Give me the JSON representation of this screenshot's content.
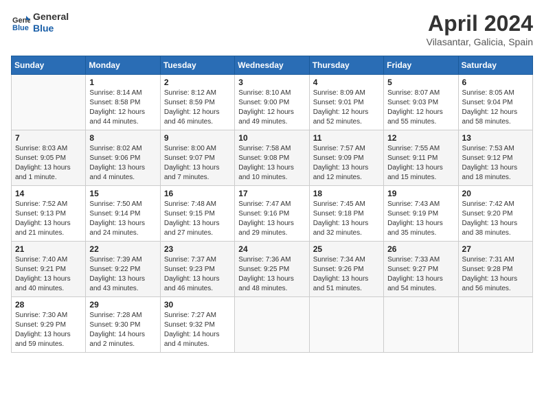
{
  "logo": {
    "line1": "General",
    "line2": "Blue"
  },
  "title": "April 2024",
  "location": "Vilasantar, Galicia, Spain",
  "days_of_week": [
    "Sunday",
    "Monday",
    "Tuesday",
    "Wednesday",
    "Thursday",
    "Friday",
    "Saturday"
  ],
  "weeks": [
    [
      null,
      {
        "num": "1",
        "sunrise": "Sunrise: 8:14 AM",
        "sunset": "Sunset: 8:58 PM",
        "daylight": "Daylight: 12 hours and 44 minutes."
      },
      {
        "num": "2",
        "sunrise": "Sunrise: 8:12 AM",
        "sunset": "Sunset: 8:59 PM",
        "daylight": "Daylight: 12 hours and 46 minutes."
      },
      {
        "num": "3",
        "sunrise": "Sunrise: 8:10 AM",
        "sunset": "Sunset: 9:00 PM",
        "daylight": "Daylight: 12 hours and 49 minutes."
      },
      {
        "num": "4",
        "sunrise": "Sunrise: 8:09 AM",
        "sunset": "Sunset: 9:01 PM",
        "daylight": "Daylight: 12 hours and 52 minutes."
      },
      {
        "num": "5",
        "sunrise": "Sunrise: 8:07 AM",
        "sunset": "Sunset: 9:03 PM",
        "daylight": "Daylight: 12 hours and 55 minutes."
      },
      {
        "num": "6",
        "sunrise": "Sunrise: 8:05 AM",
        "sunset": "Sunset: 9:04 PM",
        "daylight": "Daylight: 12 hours and 58 minutes."
      }
    ],
    [
      {
        "num": "7",
        "sunrise": "Sunrise: 8:03 AM",
        "sunset": "Sunset: 9:05 PM",
        "daylight": "Daylight: 13 hours and 1 minute."
      },
      {
        "num": "8",
        "sunrise": "Sunrise: 8:02 AM",
        "sunset": "Sunset: 9:06 PM",
        "daylight": "Daylight: 13 hours and 4 minutes."
      },
      {
        "num": "9",
        "sunrise": "Sunrise: 8:00 AM",
        "sunset": "Sunset: 9:07 PM",
        "daylight": "Daylight: 13 hours and 7 minutes."
      },
      {
        "num": "10",
        "sunrise": "Sunrise: 7:58 AM",
        "sunset": "Sunset: 9:08 PM",
        "daylight": "Daylight: 13 hours and 10 minutes."
      },
      {
        "num": "11",
        "sunrise": "Sunrise: 7:57 AM",
        "sunset": "Sunset: 9:09 PM",
        "daylight": "Daylight: 13 hours and 12 minutes."
      },
      {
        "num": "12",
        "sunrise": "Sunrise: 7:55 AM",
        "sunset": "Sunset: 9:11 PM",
        "daylight": "Daylight: 13 hours and 15 minutes."
      },
      {
        "num": "13",
        "sunrise": "Sunrise: 7:53 AM",
        "sunset": "Sunset: 9:12 PM",
        "daylight": "Daylight: 13 hours and 18 minutes."
      }
    ],
    [
      {
        "num": "14",
        "sunrise": "Sunrise: 7:52 AM",
        "sunset": "Sunset: 9:13 PM",
        "daylight": "Daylight: 13 hours and 21 minutes."
      },
      {
        "num": "15",
        "sunrise": "Sunrise: 7:50 AM",
        "sunset": "Sunset: 9:14 PM",
        "daylight": "Daylight: 13 hours and 24 minutes."
      },
      {
        "num": "16",
        "sunrise": "Sunrise: 7:48 AM",
        "sunset": "Sunset: 9:15 PM",
        "daylight": "Daylight: 13 hours and 27 minutes."
      },
      {
        "num": "17",
        "sunrise": "Sunrise: 7:47 AM",
        "sunset": "Sunset: 9:16 PM",
        "daylight": "Daylight: 13 hours and 29 minutes."
      },
      {
        "num": "18",
        "sunrise": "Sunrise: 7:45 AM",
        "sunset": "Sunset: 9:18 PM",
        "daylight": "Daylight: 13 hours and 32 minutes."
      },
      {
        "num": "19",
        "sunrise": "Sunrise: 7:43 AM",
        "sunset": "Sunset: 9:19 PM",
        "daylight": "Daylight: 13 hours and 35 minutes."
      },
      {
        "num": "20",
        "sunrise": "Sunrise: 7:42 AM",
        "sunset": "Sunset: 9:20 PM",
        "daylight": "Daylight: 13 hours and 38 minutes."
      }
    ],
    [
      {
        "num": "21",
        "sunrise": "Sunrise: 7:40 AM",
        "sunset": "Sunset: 9:21 PM",
        "daylight": "Daylight: 13 hours and 40 minutes."
      },
      {
        "num": "22",
        "sunrise": "Sunrise: 7:39 AM",
        "sunset": "Sunset: 9:22 PM",
        "daylight": "Daylight: 13 hours and 43 minutes."
      },
      {
        "num": "23",
        "sunrise": "Sunrise: 7:37 AM",
        "sunset": "Sunset: 9:23 PM",
        "daylight": "Daylight: 13 hours and 46 minutes."
      },
      {
        "num": "24",
        "sunrise": "Sunrise: 7:36 AM",
        "sunset": "Sunset: 9:25 PM",
        "daylight": "Daylight: 13 hours and 48 minutes."
      },
      {
        "num": "25",
        "sunrise": "Sunrise: 7:34 AM",
        "sunset": "Sunset: 9:26 PM",
        "daylight": "Daylight: 13 hours and 51 minutes."
      },
      {
        "num": "26",
        "sunrise": "Sunrise: 7:33 AM",
        "sunset": "Sunset: 9:27 PM",
        "daylight": "Daylight: 13 hours and 54 minutes."
      },
      {
        "num": "27",
        "sunrise": "Sunrise: 7:31 AM",
        "sunset": "Sunset: 9:28 PM",
        "daylight": "Daylight: 13 hours and 56 minutes."
      }
    ],
    [
      {
        "num": "28",
        "sunrise": "Sunrise: 7:30 AM",
        "sunset": "Sunset: 9:29 PM",
        "daylight": "Daylight: 13 hours and 59 minutes."
      },
      {
        "num": "29",
        "sunrise": "Sunrise: 7:28 AM",
        "sunset": "Sunset: 9:30 PM",
        "daylight": "Daylight: 14 hours and 2 minutes."
      },
      {
        "num": "30",
        "sunrise": "Sunrise: 7:27 AM",
        "sunset": "Sunset: 9:32 PM",
        "daylight": "Daylight: 14 hours and 4 minutes."
      },
      null,
      null,
      null,
      null
    ]
  ]
}
